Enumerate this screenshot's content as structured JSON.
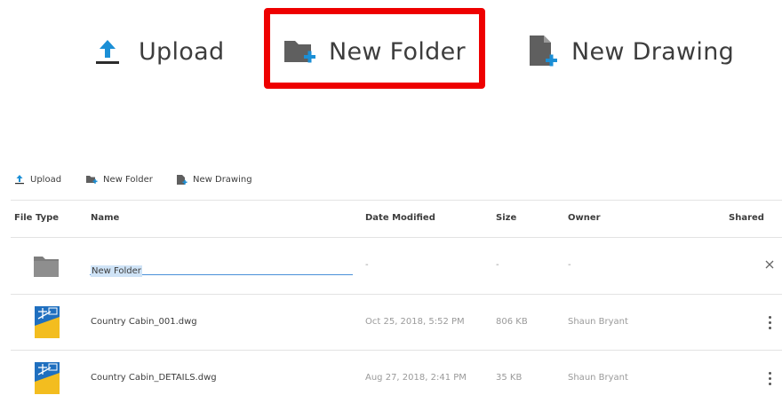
{
  "zoom_toolbar": {
    "upload_label": "Upload",
    "new_folder_label": "New Folder",
    "new_drawing_label": "New Drawing",
    "highlight_color": "#ee0000"
  },
  "toolbar": {
    "upload_label": "Upload",
    "new_folder_label": "New Folder",
    "new_drawing_label": "New Drawing"
  },
  "table": {
    "columns": [
      "File Type",
      "Name",
      "Date Modified",
      "Size",
      "Owner",
      "Shared"
    ],
    "rows": [
      {
        "type": "folder",
        "name": "New Folder",
        "editing": true,
        "date_modified": "-",
        "size": "-",
        "owner": "-",
        "action_icon": "close-icon"
      },
      {
        "type": "dwg",
        "name": "Country Cabin_001.dwg",
        "date_modified": "Oct 25, 2018, 5:52 PM",
        "size": "806 KB",
        "owner": "Shaun Bryant",
        "action_icon": "more-vertical-icon"
      },
      {
        "type": "dwg",
        "name": "Country Cabin_DETAILS.dwg",
        "date_modified": "Aug 27, 2018, 2:41 PM",
        "size": "35 KB",
        "owner": "Shaun Bryant",
        "action_icon": "more-vertical-icon"
      }
    ]
  },
  "colors": {
    "accent_blue": "#1b8fd6",
    "icon_gray": "#5f5f5f",
    "dwg_blue": "#1f6fbf",
    "dwg_yellow": "#f3bd1f"
  }
}
